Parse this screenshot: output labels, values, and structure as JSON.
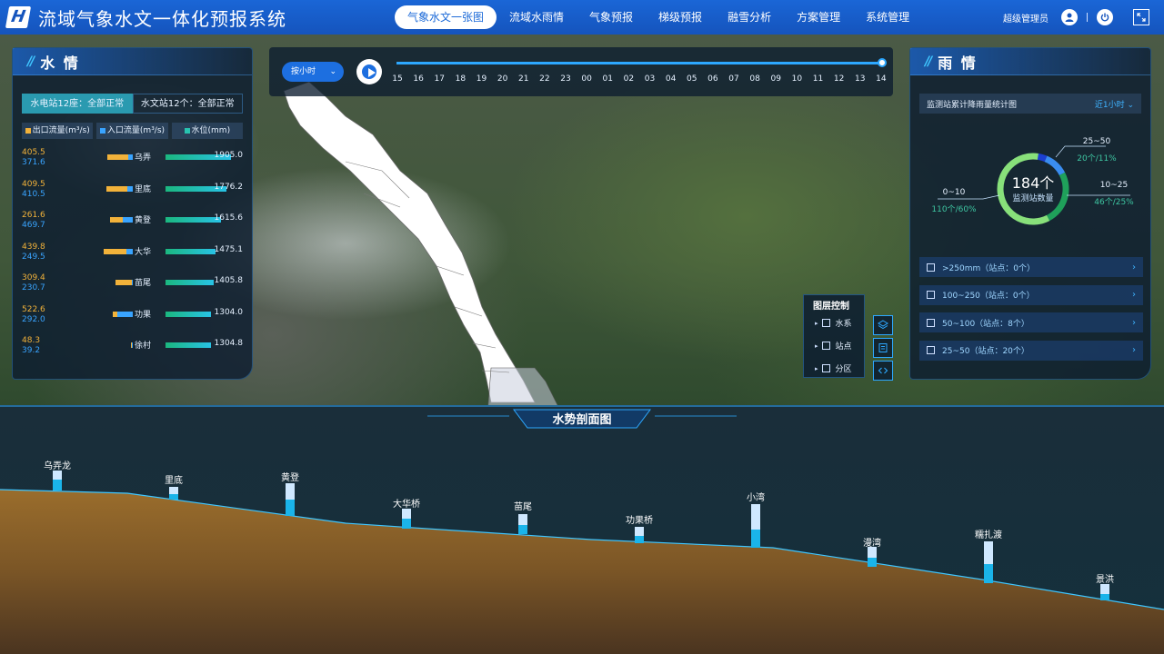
{
  "header": {
    "logo_letter": "H",
    "title": "流域气象水文一体化预报系统",
    "nav": [
      {
        "label": "气象水文一张图",
        "active": true
      },
      {
        "label": "流域水雨情",
        "active": false
      },
      {
        "label": "气象预报",
        "active": false
      },
      {
        "label": "梯级预报",
        "active": false
      },
      {
        "label": "融雪分析",
        "active": false
      },
      {
        "label": "方案管理",
        "active": false
      },
      {
        "label": "系统管理",
        "active": false
      }
    ],
    "user": "超级管理员",
    "icons": [
      "user-icon",
      "power-icon",
      "fullscreen-icon"
    ]
  },
  "water_panel": {
    "title": "水 情",
    "tabs": [
      "水电站12座：全部正常",
      "水文站12个：全部正常"
    ],
    "legend": [
      "出口流量(m³/s)",
      "入口流量(m³/s)",
      "水位(mm)"
    ],
    "colors": {
      "outflow": "#f2b23a",
      "inflow": "#39a4ff",
      "level": "#1bb77f"
    },
    "rows": [
      {
        "out": "405.5",
        "in": "371.6",
        "name": "乌弄",
        "level": "1905.0",
        "out_ratio": 0.82,
        "in_ratio": 0.18,
        "level_ratio": 1.0
      },
      {
        "out": "409.5",
        "in": "410.5",
        "name": "里底",
        "level": "1776.2",
        "out_ratio": 0.83,
        "in_ratio": 0.2,
        "level_ratio": 0.93
      },
      {
        "out": "261.6",
        "in": "469.7",
        "name": "黄登",
        "level": "1615.6",
        "out_ratio": 0.53,
        "in_ratio": 0.38,
        "level_ratio": 0.85
      },
      {
        "out": "439.8",
        "in": "249.5",
        "name": "大华",
        "level": "1475.1",
        "out_ratio": 0.89,
        "in_ratio": 0.25,
        "level_ratio": 0.77
      },
      {
        "out": "309.4",
        "in": "230.7",
        "name": "苗尾",
        "level": "1405.8",
        "out_ratio": 0.63,
        "in_ratio": 0.05,
        "level_ratio": 0.74
      },
      {
        "out": "522.6",
        "in": "292.0",
        "name": "功果",
        "level": "1304.0",
        "out_ratio": 0.2,
        "in_ratio": 0.6,
        "level_ratio": 0.7
      },
      {
        "out": "48.3",
        "in": "39.2",
        "name": "徐村",
        "level": "1304.8",
        "out_ratio": 0.02,
        "in_ratio": 0.04,
        "level_ratio": 0.7
      }
    ]
  },
  "timeline": {
    "select": "按小时",
    "ticks": [
      "15",
      "16",
      "17",
      "18",
      "19",
      "20",
      "21",
      "22",
      "23",
      "00",
      "01",
      "02",
      "03",
      "04",
      "05",
      "06",
      "07",
      "08",
      "09",
      "10",
      "11",
      "12",
      "13",
      "14"
    ],
    "progress": 1.0
  },
  "rain_panel": {
    "title": "雨 情",
    "subtitle": "监测站累计降雨量统计图",
    "range": "近1小时",
    "total": "184个",
    "total_label": "监测站数量",
    "segments": [
      {
        "range": "25~50",
        "count": "20个/11%",
        "fraction": 0.11,
        "color": "#3a8df0"
      },
      {
        "range": "10~25",
        "count": "46个/25%",
        "fraction": 0.25,
        "color": "#1fa05a"
      },
      {
        "range": "0~10",
        "count": "110个/60%",
        "fraction": 0.6,
        "color": "#88e07a"
      },
      {
        "range": "",
        "count": "",
        "fraction": 0.04,
        "color": "#1c3fd0"
      }
    ],
    "categories": [
      ">250mm（站点：0个）",
      "100~250（站点：0个）",
      "50~100（站点：8个）",
      "25~50（站点：20个）"
    ]
  },
  "layer_control": {
    "title": "图层控制",
    "layers": [
      "水系",
      "站点",
      "分区"
    ],
    "tools": [
      "layers-icon",
      "list-icon",
      "code-icon"
    ]
  },
  "profile": {
    "title": "水势剖面图",
    "sites": [
      {
        "name": "乌弄龙",
        "fill": 0.55
      },
      {
        "name": "里底",
        "fill": 0.45
      },
      {
        "name": "黄登",
        "fill": 0.5
      },
      {
        "name": "大华桥",
        "fill": 0.5
      },
      {
        "name": "苗尾",
        "fill": 0.45
      },
      {
        "name": "功果桥",
        "fill": 0.45
      },
      {
        "name": "小湾",
        "fill": 0.42
      },
      {
        "name": "漫湾",
        "fill": 0.45
      },
      {
        "name": "糯扎渡",
        "fill": 0.45
      },
      {
        "name": "景洪",
        "fill": 0.4
      }
    ]
  }
}
